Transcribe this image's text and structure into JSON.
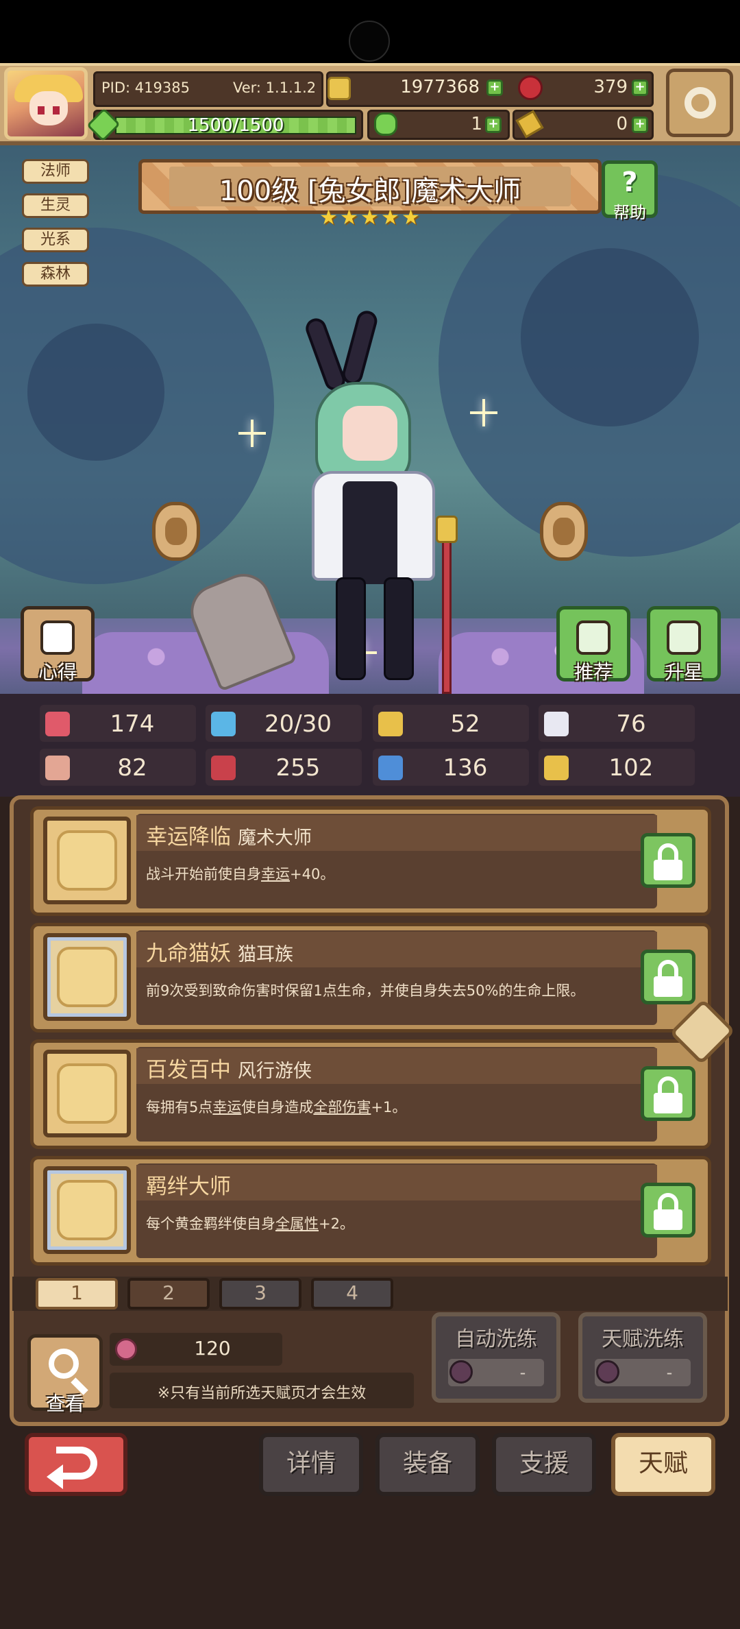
{
  "topbar": {
    "pid": "PID: 419385",
    "version": "Ver: 1.1.1.2",
    "gold": "1977368",
    "gems": "379",
    "xp_text": "1500/1500",
    "xp_progress": 1.0,
    "clover": "1",
    "keys": "0",
    "plus": "+"
  },
  "hero": {
    "title": "100级 [兔女郎]魔术大师",
    "star_count": 5,
    "star_glyph": "★",
    "help_label": "帮助",
    "help_glyph": "?",
    "tags": [
      "法师",
      "生灵",
      "光系",
      "森林"
    ],
    "buttons": {
      "notes": "心得",
      "recommend": "推荐",
      "starup": "升星"
    }
  },
  "stats": [
    {
      "icon": "heart-icon",
      "value": "174",
      "color": "#e05a6a"
    },
    {
      "icon": "mana-drop-icon",
      "value": "20/30",
      "color": "#5bb6e6"
    },
    {
      "icon": "shield-icon",
      "value": "52",
      "color": "#e8c04a"
    },
    {
      "icon": "wing-icon",
      "value": "76",
      "color": "#e8e8f2"
    },
    {
      "icon": "fist-icon",
      "value": "82",
      "color": "#e3a694"
    },
    {
      "icon": "book-icon",
      "value": "255",
      "color": "#c9414b"
    },
    {
      "icon": "boot-icon",
      "value": "136",
      "color": "#4f8ed8"
    },
    {
      "icon": "horseshoe-icon",
      "value": "102",
      "color": "#e8c04a"
    }
  ],
  "talents": [
    {
      "name": "幸运降临",
      "sub": "魔术大师",
      "desc_parts": [
        "战斗开始前使自身",
        "幸运",
        "+40。",
        "",
        ""
      ],
      "icon": "star-icon",
      "frame": "gold"
    },
    {
      "name": "九命猫妖",
      "sub": "猫耳族",
      "desc_parts": [
        "前9次受到致命伤害时保留1点生命，并使自身失去50%的生命上限。",
        "",
        "",
        "",
        ""
      ],
      "icon": "cat-icon",
      "frame": "blue"
    },
    {
      "name": "百发百中",
      "sub": "风行游侠",
      "desc_parts": [
        "每拥有5点",
        "幸运",
        "使自身造成",
        "全部伤害",
        "+1。"
      ],
      "icon": "star-icon",
      "frame": "gold"
    },
    {
      "name": "羁绊大师",
      "sub": "",
      "desc_parts": [
        "每个黄金羁绊使自身",
        "全属性",
        "+2。",
        "",
        ""
      ],
      "icon": "cross-icon",
      "frame": "blue"
    }
  ],
  "pages": [
    "1",
    "2",
    "3",
    "4"
  ],
  "bottom": {
    "look_label": "查看",
    "potion_count": "120",
    "note": "※只有当前所选天赋页才会生效",
    "auto_wash": {
      "label": "自动洗练",
      "value": "-"
    },
    "talent_wash": {
      "label": "天赋洗练",
      "value": "-"
    }
  },
  "nav": {
    "detail": "详情",
    "equip": "装备",
    "support": "支援",
    "talent": "天赋",
    "active": "talent"
  }
}
